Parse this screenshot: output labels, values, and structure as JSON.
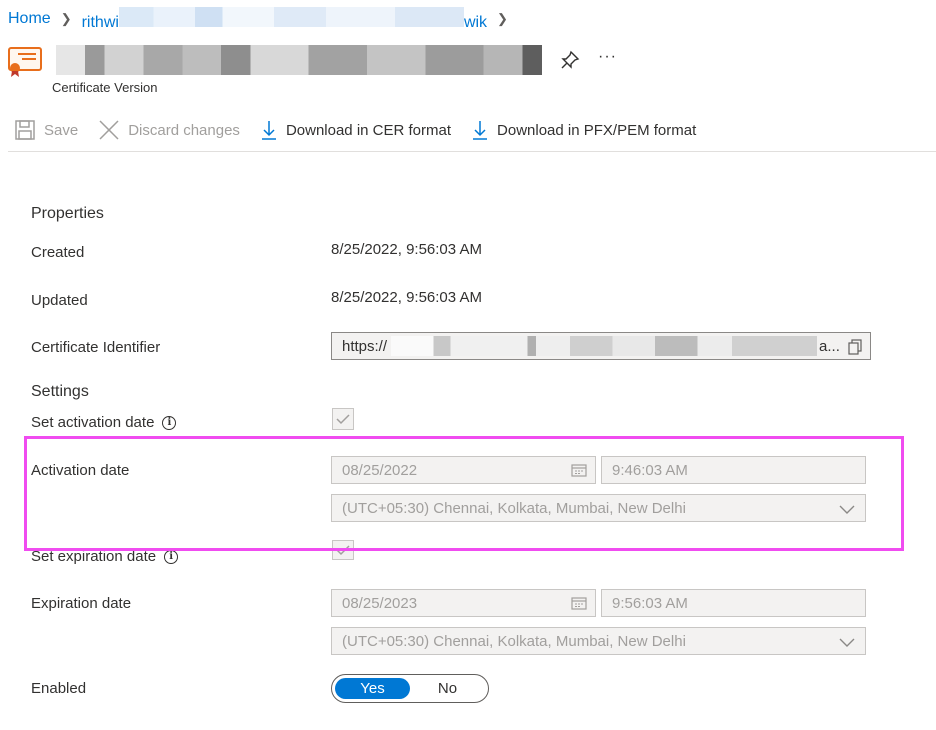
{
  "breadcrumb": {
    "home": "Home",
    "parent_start": "rithwi",
    "parent_end": "wik"
  },
  "header": {
    "subtitle": "Certificate Version",
    "more": "···"
  },
  "toolbar": {
    "save": "Save",
    "discard": "Discard changes",
    "download_cer": "Download in CER format",
    "download_pfx": "Download in PFX/PEM format"
  },
  "properties": {
    "heading": "Properties",
    "created_label": "Created",
    "created_value": "8/25/2022, 9:56:03 AM",
    "updated_label": "Updated",
    "updated_value": "8/25/2022, 9:56:03 AM",
    "identifier_label": "Certificate Identifier",
    "identifier_prefix": "https://",
    "identifier_suffix": "a..."
  },
  "settings": {
    "heading": "Settings",
    "set_activation_label": "Set activation date",
    "activation_label": "Activation date",
    "activation_date": "08/25/2022",
    "activation_time": "9:46:03 AM",
    "activation_tz": "(UTC+05:30) Chennai, Kolkata, Mumbai, New Delhi",
    "set_expiration_label": "Set expiration date",
    "expiration_label": "Expiration date",
    "expiration_date": "08/25/2023",
    "expiration_time": "9:56:03 AM",
    "expiration_tz": "(UTC+05:30) Chennai, Kolkata, Mumbai, New Delhi",
    "enabled_label": "Enabled",
    "enabled_yes": "Yes",
    "enabled_no": "No",
    "enabled_selected": "Yes"
  },
  "colors": {
    "accent": "#0078d4",
    "highlight": "#f04cf0",
    "icon_orange": "#e86e1c"
  }
}
